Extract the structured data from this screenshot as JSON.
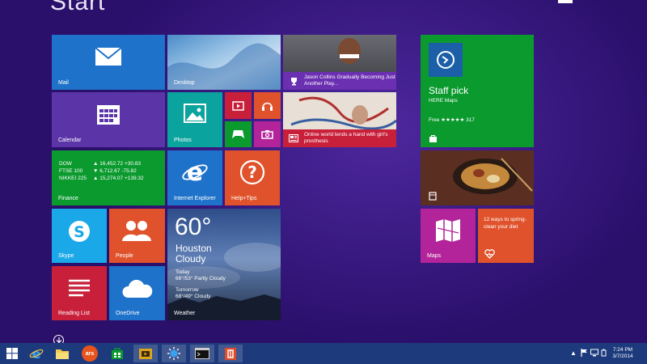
{
  "screen": {
    "title": "Start"
  },
  "tiles": {
    "mail": {
      "label": "Mail",
      "color": "#1f72c9"
    },
    "desktop": {
      "label": "Desktop"
    },
    "calendar": {
      "label": "Calendar",
      "color": "#5b35a8"
    },
    "photos": {
      "label": "Photos",
      "color": "#0aa39d"
    },
    "finance": {
      "label": "Finance",
      "color": "#0b9a2e",
      "rows": [
        {
          "symbol": "DOW",
          "quote": "▲ 16,452.72 +30.83"
        },
        {
          "symbol": "FTSE 100",
          "quote": "▼ 6,712.67 -75.82"
        },
        {
          "symbol": "NIKKEI 225",
          "quote": "▲ 15,274.07 +139.32"
        }
      ]
    },
    "internet_explorer": {
      "label": "Internet Explorer",
      "color": "#1f72c9"
    },
    "help_tips": {
      "label": "Help+Tips",
      "color": "#e0522b"
    },
    "skype": {
      "label": "Skype",
      "color": "#1aa8e8"
    },
    "people": {
      "label": "People",
      "color": "#e0522b"
    },
    "reading_list": {
      "label": "Reading List",
      "color": "#c8203b"
    },
    "onedrive": {
      "label": "OneDrive",
      "color": "#1f72c9"
    },
    "weather": {
      "label": "Weather",
      "temp": "60°",
      "city": "Houston",
      "condition": "Cloudy",
      "today_label": "Today",
      "today_forecast": "66°/53° Partly Cloudy",
      "tomorrow_label": "Tomorrow",
      "tomorrow_forecast": "68°/49° Cloudy"
    },
    "sports_news": {
      "text": "Jason Collins Gradually Becoming Just Another Play...",
      "band_color": "#6b2fb2"
    },
    "news": {
      "text": "Online world lends a hand with girl's prosthesis",
      "band_color": "#c8203b"
    },
    "store": {
      "title": "Staff pick",
      "subtitle": "HERE Maps",
      "price_line": "Free ★★★★★ 317",
      "color": "#0b9a2e"
    },
    "maps": {
      "label": "Maps",
      "color": "#b3249a"
    },
    "health": {
      "text": "12 ways to spring-clean your diet",
      "color": "#e0522b"
    },
    "small": {
      "video_color": "#c8203b",
      "music_color": "#e0522b",
      "games_color": "#0b9a2e",
      "camera_color": "#b3249a"
    }
  },
  "taskbar": {
    "color": "#1d3a7c",
    "ars_label": "ars",
    "clock_time": "7:24 PM",
    "clock_date": "3/7/2014"
  }
}
